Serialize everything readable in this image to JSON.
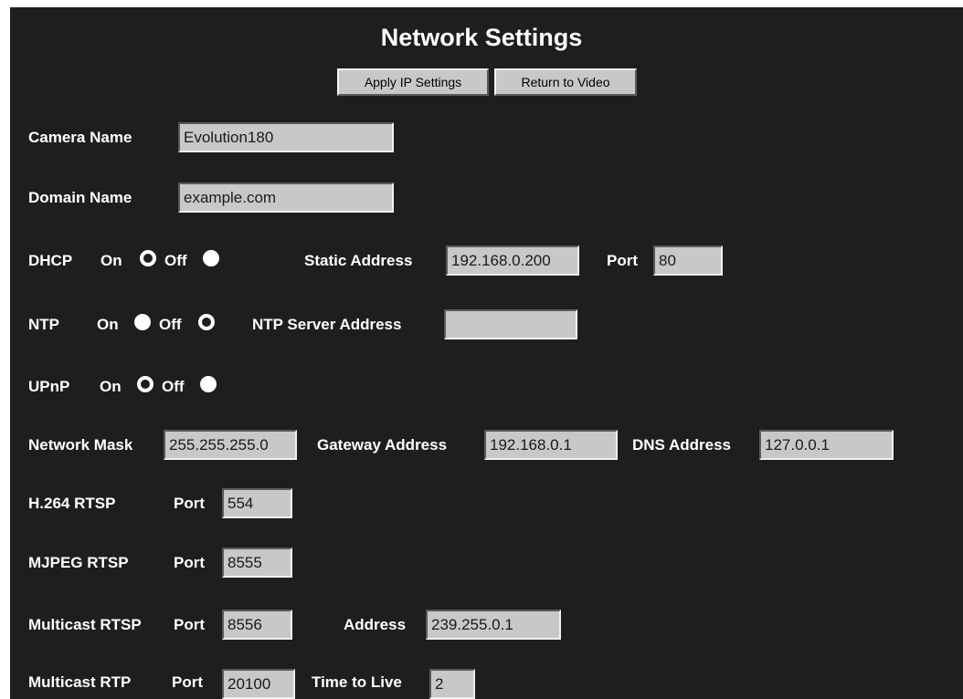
{
  "page": {
    "title": "Network Settings"
  },
  "toolbar": {
    "apply_label": "Apply IP Settings",
    "return_label": "Return to Video"
  },
  "camera_name": {
    "label": "Camera Name",
    "value": "Evolution180"
  },
  "domain_name": {
    "label": "Domain Name",
    "value": "example.com"
  },
  "dhcp": {
    "label": "DHCP",
    "on_label": "On",
    "off_label": "Off",
    "selected": "On",
    "static_address_label": "Static Address",
    "static_address_value": "192.168.0.200",
    "port_label": "Port",
    "port_value": "80"
  },
  "ntp": {
    "label": "NTP",
    "on_label": "On",
    "off_label": "Off",
    "selected": "Off",
    "server_label": "NTP Server Address",
    "server_value": ""
  },
  "upnp": {
    "label": "UPnP",
    "on_label": "On",
    "off_label": "Off",
    "selected": "On"
  },
  "network": {
    "mask_label": "Network Mask",
    "mask_value": "255.255.255.0",
    "gateway_label": "Gateway Address",
    "gateway_value": "192.168.0.1",
    "dns_label": "DNS Address",
    "dns_value": "127.0.0.1"
  },
  "h264_rtsp": {
    "label": "H.264 RTSP",
    "port_label": "Port",
    "port_value": "554"
  },
  "mjpeg_rtsp": {
    "label": "MJPEG RTSP",
    "port_label": "Port",
    "port_value": "8555"
  },
  "multicast_rtsp": {
    "label": "Multicast RTSP",
    "port_label": "Port",
    "port_value": "8556",
    "address_label": "Address",
    "address_value": "239.255.0.1"
  },
  "multicast_rtp": {
    "label": "Multicast RTP",
    "port_label": "Port",
    "port_value": "20100",
    "ttl_label": "Time to Live",
    "ttl_value": "2"
  },
  "colors": {
    "panel_bg": "#1e1e1e",
    "field_bg": "#c8c8c8",
    "button_bg": "#c8c8c8",
    "text": "#ffffff"
  }
}
